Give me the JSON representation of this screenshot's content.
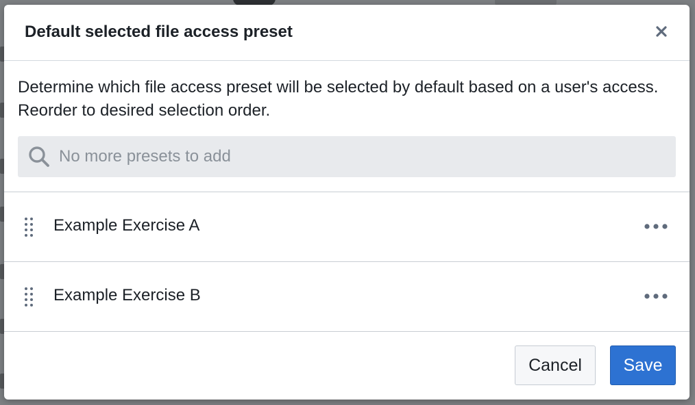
{
  "dialog": {
    "title": "Default selected file access preset",
    "description": "Determine which file access preset will be selected by default based on a user's access. Reorder to desired selection order."
  },
  "search": {
    "placeholder": "No more presets to add"
  },
  "presets": [
    {
      "label": "Example Exercise A"
    },
    {
      "label": "Example Exercise B"
    }
  ],
  "footer": {
    "cancel_label": "Cancel",
    "save_label": "Save"
  },
  "colors": {
    "primary": "#2d72d2",
    "text": "#1c2127",
    "search_bg": "#e8eaed",
    "placeholder": "#8a9199",
    "overlay": "#5f6265"
  },
  "icons": {
    "close": "close-icon",
    "search": "search-icon",
    "drag": "drag-handle-icon",
    "more": "more-horizontal-icon"
  }
}
